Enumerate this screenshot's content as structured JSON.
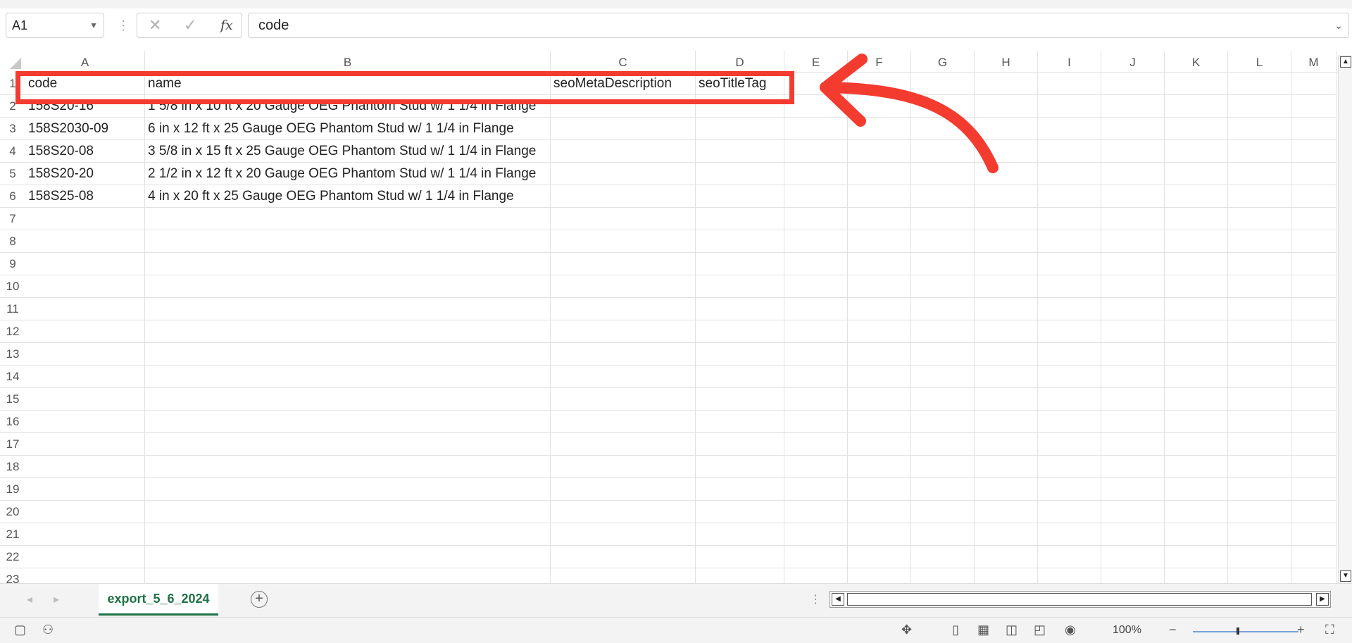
{
  "formula_bar": {
    "name_box": "A1",
    "formula": "code",
    "cancel_icon": "close-icon",
    "enter_icon": "check-icon",
    "fx_label": "fx"
  },
  "columns": [
    "A",
    "B",
    "C",
    "D",
    "E",
    "F",
    "G",
    "H",
    "I",
    "J",
    "K",
    "L",
    "M"
  ],
  "rows": [
    {
      "num": "1",
      "cells": [
        "code",
        "name",
        "seoMetaDescription",
        "seoTitleTag"
      ]
    },
    {
      "num": "2",
      "cells": [
        "158S20-16",
        "1 5/8 in x 10 ft x 20 Gauge OEG Phantom Stud w/ 1 1/4 in Flange",
        "",
        ""
      ]
    },
    {
      "num": "3",
      "cells": [
        "158S2030-09",
        "6 in x 12 ft x 25 Gauge OEG Phantom Stud w/ 1 1/4 in Flange",
        "",
        ""
      ]
    },
    {
      "num": "4",
      "cells": [
        "158S20-08",
        "3 5/8 in x 15 ft x 25 Gauge OEG Phantom Stud w/ 1 1/4 in Flange",
        "",
        ""
      ]
    },
    {
      "num": "5",
      "cells": [
        "158S20-20",
        "2 1/2 in x 12 ft x 20 Gauge OEG Phantom Stud w/ 1 1/4 in Flange",
        "",
        ""
      ]
    },
    {
      "num": "6",
      "cells": [
        "158S25-08",
        "4 in x 20 ft x 25 Gauge OEG Phantom Stud w/ 1 1/4 in Flange",
        "",
        ""
      ]
    },
    {
      "num": "7",
      "cells": [
        "",
        "",
        "",
        ""
      ]
    },
    {
      "num": "8",
      "cells": [
        "",
        "",
        "",
        ""
      ]
    },
    {
      "num": "9",
      "cells": [
        "",
        "",
        "",
        ""
      ]
    },
    {
      "num": "10",
      "cells": [
        "",
        "",
        "",
        ""
      ]
    },
    {
      "num": "11",
      "cells": [
        "",
        "",
        "",
        ""
      ]
    },
    {
      "num": "12",
      "cells": [
        "",
        "",
        "",
        ""
      ]
    },
    {
      "num": "13",
      "cells": [
        "",
        "",
        "",
        ""
      ]
    },
    {
      "num": "14",
      "cells": [
        "",
        "",
        "",
        ""
      ]
    },
    {
      "num": "15",
      "cells": [
        "",
        "",
        "",
        ""
      ]
    },
    {
      "num": "16",
      "cells": [
        "",
        "",
        "",
        ""
      ]
    },
    {
      "num": "17",
      "cells": [
        "",
        "",
        "",
        ""
      ]
    },
    {
      "num": "18",
      "cells": [
        "",
        "",
        "",
        ""
      ]
    },
    {
      "num": "19",
      "cells": [
        "",
        "",
        "",
        ""
      ]
    },
    {
      "num": "20",
      "cells": [
        "",
        "",
        "",
        ""
      ]
    },
    {
      "num": "21",
      "cells": [
        "",
        "",
        "",
        ""
      ]
    },
    {
      "num": "22",
      "cells": [
        "",
        "",
        "",
        ""
      ]
    },
    {
      "num": "23",
      "cells": [
        "",
        "",
        "",
        ""
      ]
    }
  ],
  "sheet_tabs": [
    "export_5_6_2024"
  ],
  "status_bar": {
    "zoom": "100%",
    "zoom_out": "−",
    "zoom_in": "+"
  },
  "colors": {
    "accent": "#1e7145",
    "annotation": "#f33b2f",
    "grid": "#e2e2e2"
  },
  "annotation": {
    "type": "highlight-box-with-arrow",
    "target": "header-row-1"
  }
}
